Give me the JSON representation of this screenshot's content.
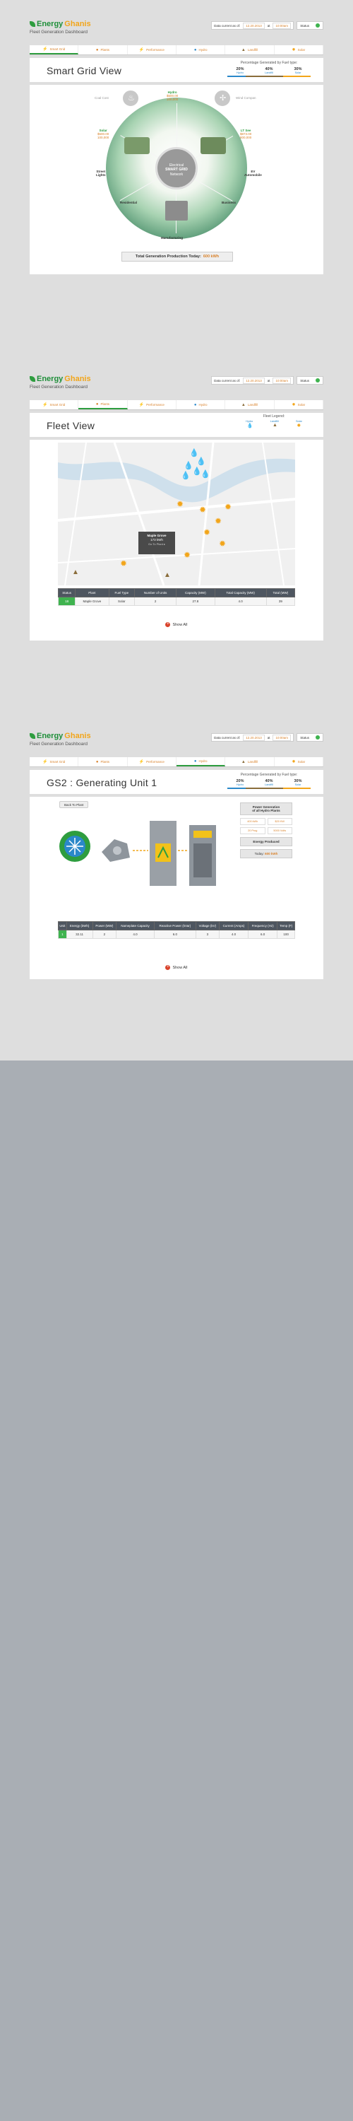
{
  "brand": {
    "word1": "Energy",
    "word2": "Ghanis",
    "subtitle": "Fleet Generation Dashboard"
  },
  "datebar": {
    "label": "Data current as of:",
    "date": "12.20.2013",
    "at": "at",
    "time": "10:00am"
  },
  "status": {
    "label": "Status"
  },
  "nav": [
    {
      "label": "Smart Grid",
      "icon": "smart-grid-icon"
    },
    {
      "label": "Plants",
      "icon": "plants-icon"
    },
    {
      "label": "Performance",
      "icon": "performance-icon"
    },
    {
      "label": "Hydro",
      "icon": "hydro-icon"
    },
    {
      "label": "Landfill",
      "icon": "landfill-icon"
    },
    {
      "label": "Solar",
      "icon": "solar-icon"
    }
  ],
  "fuel_pct": {
    "header": "Percentage Generated by Fuel type:",
    "items": [
      {
        "value": "20%",
        "label": "Hydro",
        "color": "#2a88c9",
        "share": 20
      },
      {
        "value": "40%",
        "label": "Landfill",
        "color": "#8a6d3b",
        "share": 40
      },
      {
        "value": "30%",
        "label": "Solar",
        "color": "#f2a51a",
        "share": 30
      }
    ]
  },
  "view1": {
    "title": "Smart Grid View",
    "hub": [
      "Electrical",
      "SMART GRID",
      "Network"
    ],
    "hydro": {
      "name": "Hydro",
      "v1": "$500.00",
      "v2": "100,000"
    },
    "solar": {
      "name": "Solar",
      "v1": "$500.00",
      "v2": "100,000"
    },
    "ltsee": {
      "name": "LT See",
      "v1": "$873.00",
      "v2": "800,000"
    },
    "coal": "Coal Cost",
    "wind": "Wind Compan",
    "street": [
      "Street",
      "Lights"
    ],
    "ev": [
      "EV",
      "Automobile"
    ],
    "residential": "Residential",
    "manufacturing": "Manufacturing",
    "business": "Business",
    "total_label": "Total Generation Production Today:",
    "total_value": "600 kWh"
  },
  "view2": {
    "title": "Fleet View",
    "legend": {
      "header": "Fleet Legend:",
      "items": [
        "Hydro",
        "Landfill",
        "Solar"
      ]
    },
    "tooltip": {
      "name": "Maple Grove",
      "value": "173 kWh",
      "link": "Go To Plant"
    },
    "table": {
      "headers": [
        "Status",
        "Plant",
        "Fuel Type",
        "Number of Units",
        "Capacity (MW)",
        "Total Capacity (MW)",
        "Total (MW)"
      ],
      "row": [
        "18",
        "Maple Grove",
        "Solar",
        "2",
        "27.8",
        "4.0",
        "39"
      ]
    },
    "show_all": "Show All"
  },
  "view3": {
    "title": "GS2 : Generating Unit 1",
    "back": "Back To Plant",
    "panel": {
      "header": [
        "Power Generation",
        "of all Hydro Plants"
      ],
      "tags": [
        "400 kWh",
        "$20 KW",
        "20 Prog",
        "5000 Volts"
      ],
      "energy_label": "Energy Produced",
      "today_label": "Today:",
      "today_value": "600 kWh"
    },
    "table": {
      "headers": [
        "Unit",
        "Energy (kWh)",
        "Power (MW)",
        "Nameplate Capacity",
        "Reactive Power (kVar)",
        "Voltage (kV)",
        "Current (Amps)",
        "Frequency (Hz)",
        "Temp (F)"
      ],
      "row": [
        "1",
        "32.11",
        "2",
        "4.0",
        "6.0",
        "3",
        "4.0",
        "6.0",
        "100"
      ]
    },
    "show_all": "Show All"
  }
}
